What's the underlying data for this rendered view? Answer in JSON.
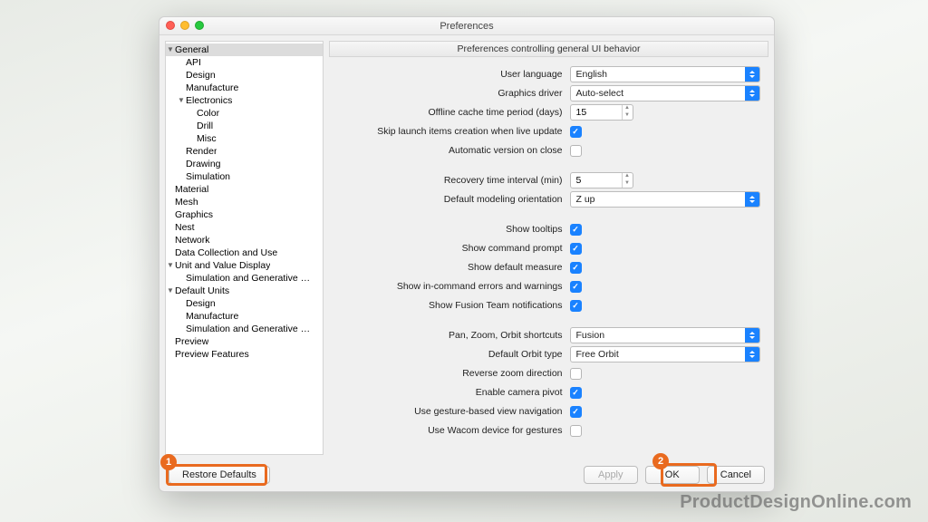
{
  "window": {
    "title": "Preferences"
  },
  "main_header": "Preferences controlling general UI behavior",
  "sidebar": {
    "items": [
      {
        "label": "General",
        "kind": "branch",
        "open": true,
        "depth": 0,
        "selected": true
      },
      {
        "label": "API",
        "kind": "leaf",
        "depth": 1
      },
      {
        "label": "Design",
        "kind": "leaf",
        "depth": 1
      },
      {
        "label": "Manufacture",
        "kind": "leaf",
        "depth": 1
      },
      {
        "label": "Electronics",
        "kind": "branch",
        "open": true,
        "depth": 1
      },
      {
        "label": "Color",
        "kind": "leaf",
        "depth": 2
      },
      {
        "label": "Drill",
        "kind": "leaf",
        "depth": 2
      },
      {
        "label": "Misc",
        "kind": "leaf",
        "depth": 2
      },
      {
        "label": "Render",
        "kind": "leaf",
        "depth": 1
      },
      {
        "label": "Drawing",
        "kind": "leaf",
        "depth": 1
      },
      {
        "label": "Simulation",
        "kind": "leaf",
        "depth": 1
      },
      {
        "label": "Material",
        "kind": "leaf",
        "depth": 0
      },
      {
        "label": "Mesh",
        "kind": "leaf",
        "depth": 0
      },
      {
        "label": "Graphics",
        "kind": "leaf",
        "depth": 0
      },
      {
        "label": "Nest",
        "kind": "leaf",
        "depth": 0
      },
      {
        "label": "Network",
        "kind": "leaf",
        "depth": 0
      },
      {
        "label": "Data Collection and Use",
        "kind": "leaf",
        "depth": 0
      },
      {
        "label": "Unit and Value Display",
        "kind": "branch",
        "open": true,
        "depth": 0
      },
      {
        "label": "Simulation and Generative Desi…",
        "kind": "leaf",
        "depth": 1
      },
      {
        "label": "Default Units",
        "kind": "branch",
        "open": true,
        "depth": 0
      },
      {
        "label": "Design",
        "kind": "leaf",
        "depth": 1
      },
      {
        "label": "Manufacture",
        "kind": "leaf",
        "depth": 1
      },
      {
        "label": "Simulation and Generative Desi…",
        "kind": "leaf",
        "depth": 1
      },
      {
        "label": "Preview",
        "kind": "leaf",
        "depth": 0
      },
      {
        "label": "Preview Features",
        "kind": "leaf",
        "depth": 0
      }
    ]
  },
  "settings": {
    "user_language": {
      "label": "User language",
      "value": "English"
    },
    "graphics_driver": {
      "label": "Graphics driver",
      "value": "Auto-select"
    },
    "offline_cache": {
      "label": "Offline cache time period (days)",
      "value": "15"
    },
    "skip_launch": {
      "label": "Skip launch items creation when live update",
      "checked": true
    },
    "auto_version": {
      "label": "Automatic version on close",
      "checked": false
    },
    "recovery_interval": {
      "label": "Recovery time interval (min)",
      "value": "5"
    },
    "default_orientation": {
      "label": "Default modeling orientation",
      "value": "Z up"
    },
    "show_tooltips": {
      "label": "Show tooltips",
      "checked": true
    },
    "show_cmd_prompt": {
      "label": "Show command prompt",
      "checked": true
    },
    "show_default_measure": {
      "label": "Show default measure",
      "checked": true
    },
    "show_in_cmd_errors": {
      "label": "Show in-command errors and warnings",
      "checked": true
    },
    "show_fusion_team": {
      "label": "Show Fusion Team notifications",
      "checked": true
    },
    "shortcuts": {
      "label": "Pan, Zoom, Orbit shortcuts",
      "value": "Fusion"
    },
    "orbit_type": {
      "label": "Default Orbit type",
      "value": "Free Orbit"
    },
    "reverse_zoom": {
      "label": "Reverse zoom direction",
      "checked": false
    },
    "camera_pivot": {
      "label": "Enable camera pivot",
      "checked": true
    },
    "gesture_nav": {
      "label": "Use gesture-based view navigation",
      "checked": true
    },
    "wacom": {
      "label": "Use Wacom device for gestures",
      "checked": false
    }
  },
  "buttons": {
    "restore": "Restore Defaults",
    "apply": "Apply",
    "ok": "OK",
    "cancel": "Cancel"
  },
  "annotations": {
    "one": "1",
    "two": "2"
  },
  "watermark": "ProductDesignOnline.com"
}
